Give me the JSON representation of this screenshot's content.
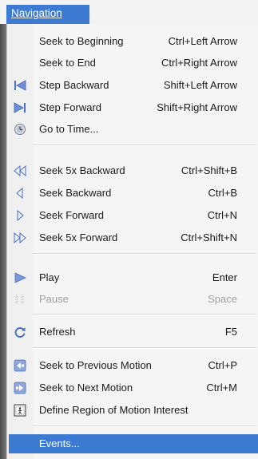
{
  "menubar": {
    "title": "Navigation"
  },
  "items": [
    {
      "label": "Seek to Beginning",
      "shortcut": "Ctrl+Left Arrow"
    },
    {
      "label": "Seek to End",
      "shortcut": "Ctrl+Right Arrow"
    },
    {
      "label": "Step Backward",
      "shortcut": "Shift+Left Arrow",
      "icon": "step-backward-icon"
    },
    {
      "label": "Step Forward",
      "shortcut": "Shift+Right Arrow",
      "icon": "step-forward-icon"
    },
    {
      "label": "Go to Time...",
      "shortcut": "",
      "icon": "clock-icon"
    },
    {
      "label": "Seek 5x Backward",
      "shortcut": "Ctrl+Shift+B",
      "icon": "fast-backward-icon"
    },
    {
      "label": "Seek Backward",
      "shortcut": "Ctrl+B",
      "icon": "backward-icon"
    },
    {
      "label": "Seek Forward",
      "shortcut": "Ctrl+N",
      "icon": "forward-icon"
    },
    {
      "label": "Seek 5x Forward",
      "shortcut": "Ctrl+Shift+N",
      "icon": "fast-forward-icon"
    },
    {
      "label": "Play",
      "shortcut": "Enter",
      "icon": "play-icon"
    },
    {
      "label": "Pause",
      "shortcut": "Space",
      "icon": "pause-icon",
      "disabled": true
    },
    {
      "label": "Refresh",
      "shortcut": "F5",
      "icon": "refresh-icon"
    },
    {
      "label": "Seek to Previous Motion",
      "shortcut": "Ctrl+P",
      "icon": "previous-motion-icon"
    },
    {
      "label": "Seek to Next Motion",
      "shortcut": "Ctrl+M",
      "icon": "next-motion-icon"
    },
    {
      "label": "Define Region of Motion Interest",
      "shortcut": "",
      "icon": "motion-region-icon"
    },
    {
      "label": "Events...",
      "shortcut": "",
      "highlighted": true
    }
  ],
  "colors": {
    "highlight": "#3d7ad1",
    "icon_blue": "#4a6fc0",
    "disabled": "#a0a0a0"
  }
}
